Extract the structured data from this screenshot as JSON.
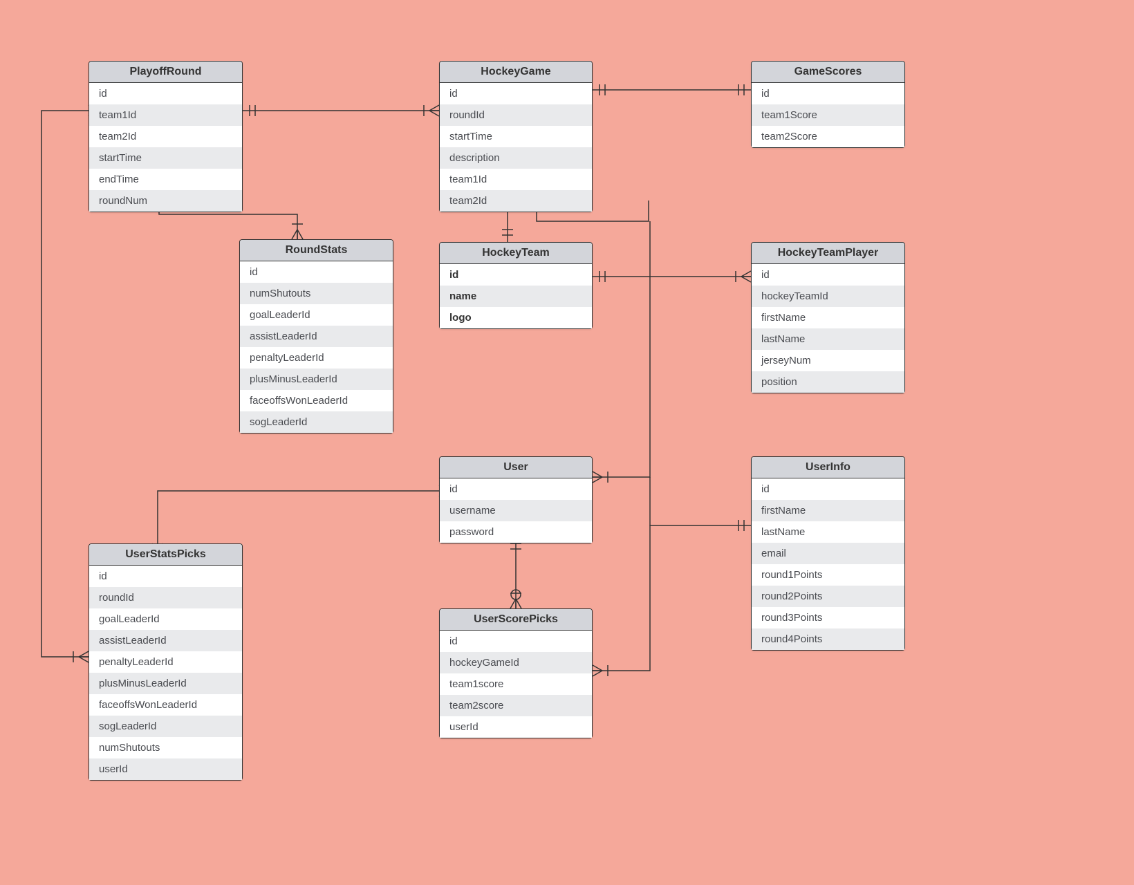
{
  "entities": {
    "playoffRound": {
      "title": "PlayoffRound",
      "fields": [
        "id",
        "team1Id",
        "team2Id",
        "startTime",
        "endTime",
        "roundNum"
      ]
    },
    "hockeyGame": {
      "title": "HockeyGame",
      "fields": [
        "id",
        "roundId",
        "startTime",
        "description",
        "team1Id",
        "team2Id"
      ]
    },
    "gameScores": {
      "title": "GameScores",
      "fields": [
        "id",
        "team1Score",
        "team2Score"
      ]
    },
    "roundStats": {
      "title": "RoundStats",
      "fields": [
        "id",
        "numShutouts",
        "goalLeaderId",
        "assistLeaderId",
        "penaltyLeaderId",
        "plusMinusLeaderId",
        "faceoffsWonLeaderId",
        "sogLeaderId"
      ]
    },
    "hockeyTeam": {
      "title": "HockeyTeam",
      "fields": [
        "id",
        "name",
        "logo"
      ],
      "boldAll": true
    },
    "hockeyTeamPlayer": {
      "title": "HockeyTeamPlayer",
      "fields": [
        "id",
        "hockeyTeamId",
        "firstName",
        "lastName",
        "jerseyNum",
        "position"
      ]
    },
    "user": {
      "title": "User",
      "fields": [
        "id",
        "username",
        "password"
      ]
    },
    "userInfo": {
      "title": "UserInfo",
      "fields": [
        "id",
        "firstName",
        "lastName",
        "email",
        "round1Points",
        "round2Points",
        "round3Points",
        "round4Points"
      ]
    },
    "userStatsPicks": {
      "title": "UserStatsPicks",
      "fields": [
        "id",
        "roundId",
        "goalLeaderId",
        "assistLeaderId",
        "penaltyLeaderId",
        "plusMinusLeaderId",
        "faceoffsWonLeaderId",
        "sogLeaderId",
        "numShutouts",
        "userId"
      ]
    },
    "userScorePicks": {
      "title": "UserScorePicks",
      "fields": [
        "id",
        "hockeyGameId",
        "team1score",
        "team2score",
        "userId"
      ]
    }
  }
}
